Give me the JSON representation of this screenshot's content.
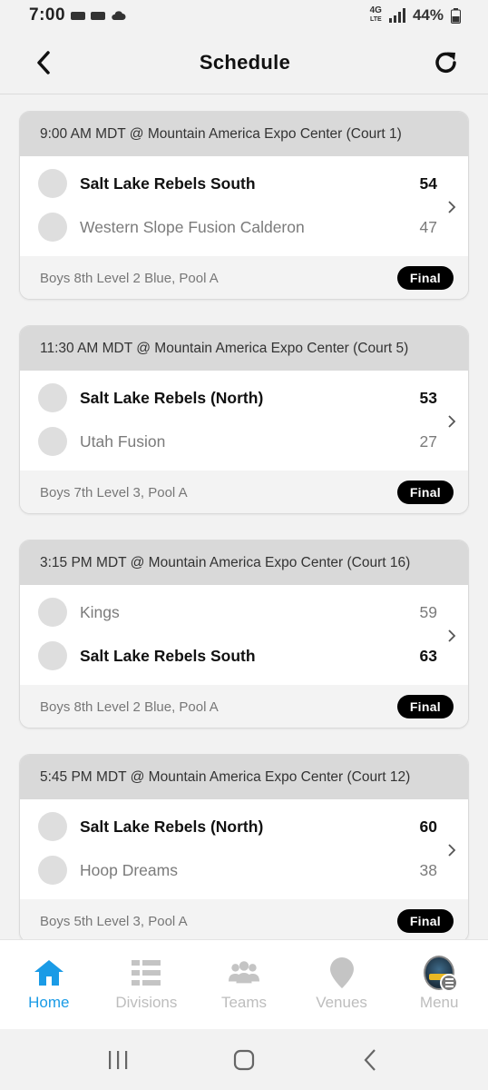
{
  "status_bar": {
    "time": "7:00",
    "network": "4G",
    "network_sub": "LTE",
    "battery": "44%"
  },
  "header": {
    "title": "Schedule",
    "back_icon": "chevron-left-icon",
    "refresh_icon": "refresh-icon"
  },
  "games": [
    {
      "header": "9:00 AM MDT @ Mountain America Expo Center (Court 1)",
      "teams": [
        {
          "name": "Salt Lake Rebels South",
          "score": "54",
          "winner": true
        },
        {
          "name": "Western Slope Fusion Calderon",
          "score": "47",
          "winner": false
        }
      ],
      "division": "Boys 8th Level 2 Blue, Pool A",
      "status": "Final"
    },
    {
      "header": "11:30 AM MDT @ Mountain America Expo Center (Court 5)",
      "teams": [
        {
          "name": "Salt Lake Rebels (North)",
          "score": "53",
          "winner": true
        },
        {
          "name": "Utah Fusion",
          "score": "27",
          "winner": false
        }
      ],
      "division": "Boys 7th Level 3, Pool A",
      "status": "Final"
    },
    {
      "header": "3:15 PM MDT @ Mountain America Expo Center (Court 16)",
      "teams": [
        {
          "name": "Kings",
          "score": "59",
          "winner": false
        },
        {
          "name": "Salt Lake Rebels South",
          "score": "63",
          "winner": true
        }
      ],
      "division": "Boys 8th Level 2 Blue, Pool A",
      "status": "Final"
    },
    {
      "header": "5:45 PM MDT @ Mountain America Expo Center (Court 12)",
      "teams": [
        {
          "name": "Salt Lake Rebels (North)",
          "score": "60",
          "winner": true
        },
        {
          "name": "Hoop Dreams",
          "score": "38",
          "winner": false
        }
      ],
      "division": "Boys 5th Level 3, Pool A",
      "status": "Final"
    }
  ],
  "bottom_nav": {
    "items": [
      {
        "label": "Home",
        "icon": "home-icon",
        "active": true
      },
      {
        "label": "Divisions",
        "icon": "list-icon",
        "active": false
      },
      {
        "label": "Teams",
        "icon": "people-icon",
        "active": false
      },
      {
        "label": "Venues",
        "icon": "map-pin-icon",
        "active": false
      },
      {
        "label": "Menu",
        "icon": "menu-avatar-icon",
        "active": false
      }
    ]
  },
  "colors": {
    "accent": "#1a9be6",
    "header_band": "#d9d9d9",
    "badge_bg": "#000000",
    "inactive_nav": "#bdbdbd"
  }
}
